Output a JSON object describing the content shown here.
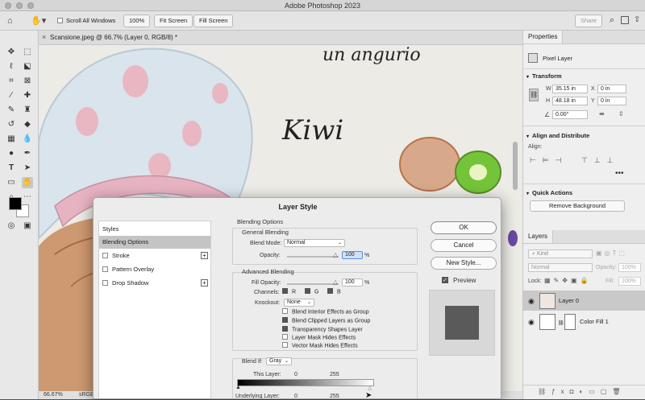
{
  "app": {
    "title": "Adobe Photoshop 2023"
  },
  "options_bar": {
    "scroll_all_windows": "Scroll All Windows",
    "zoom_100": "100%",
    "fit_screen": "Fit Screen",
    "fill_screen": "Fill Screen",
    "share": "Share"
  },
  "document": {
    "tab_title": "Scansione.jpeg @ 66.7% (Layer 0, RGB/8) *",
    "zoom": "66.67%",
    "profile": "sRGB",
    "canvas_text_top": "un angurio",
    "canvas_text_main": "Kiwi"
  },
  "properties": {
    "tab": "Properties",
    "kind": "Pixel Layer",
    "transform_title": "Transform",
    "w_label": "W",
    "w_value": "35.15 in",
    "x_label": "X",
    "x_value": "0 in",
    "h_label": "H",
    "h_value": "48.18 in",
    "y_label": "Y",
    "y_value": "0 in",
    "angle_value": "0.00°",
    "align_title": "Align and Distribute",
    "align_label": "Align:",
    "quick_actions_title": "Quick Actions",
    "remove_bg": "Remove Background"
  },
  "layers_panel": {
    "tab": "Layers",
    "kind_filter": "Kind",
    "blend_mode": "Normal",
    "opacity_label": "Opacity:",
    "opacity_value": "100%",
    "lock_label": "Lock:",
    "fill_label": "Fill:",
    "fill_value": "100%",
    "layers": [
      {
        "name": "Layer 0",
        "selected": true
      },
      {
        "name": "Color Fill 1",
        "selected": false
      }
    ]
  },
  "dialog": {
    "title": "Layer Style",
    "styles_header": "Styles",
    "style_items": [
      {
        "label": "Blending Options",
        "selected": true,
        "checkbox": false,
        "plus": false
      },
      {
        "label": "Stroke",
        "selected": false,
        "checkbox": true,
        "plus": true
      },
      {
        "label": "Pattern Overlay",
        "selected": false,
        "checkbox": true,
        "plus": false
      },
      {
        "label": "Drop Shadow",
        "selected": false,
        "checkbox": true,
        "plus": true
      }
    ],
    "blending_options": "Blending Options",
    "general_blending": "General Blending",
    "blend_mode_label": "Blend Mode:",
    "blend_mode_value": "Normal",
    "opacity_label": "Opacity:",
    "opacity_value": "100",
    "percent": "%",
    "advanced_blending": "Advanced Blending",
    "fill_opacity_label": "Fill Opacity:",
    "fill_opacity_value": "100",
    "channels_label": "Channels:",
    "channel_r": "R",
    "channel_g": "G",
    "channel_b": "B",
    "knockout_label": "Knockout:",
    "knockout_value": "None",
    "options": [
      {
        "label": "Blend Interior Effects as Group",
        "checked": false
      },
      {
        "label": "Blend Clipped Layers as Group",
        "checked": true
      },
      {
        "label": "Transparency Shapes Layer",
        "checked": true
      },
      {
        "label": "Layer Mask Hides Effects",
        "checked": false
      },
      {
        "label": "Vector Mask Hides Effects",
        "checked": false
      }
    ],
    "blend_if_label": "Blend If:",
    "blend_if_value": "Gray",
    "this_layer_label": "This Layer:",
    "this_layer_min": "0",
    "this_layer_max": "255",
    "underlying_label": "Underlying Layer:",
    "underlying_min": "0",
    "underlying_max": "255",
    "ok": "OK",
    "cancel": "Cancel",
    "new_style": "New Style...",
    "preview": "Preview"
  }
}
